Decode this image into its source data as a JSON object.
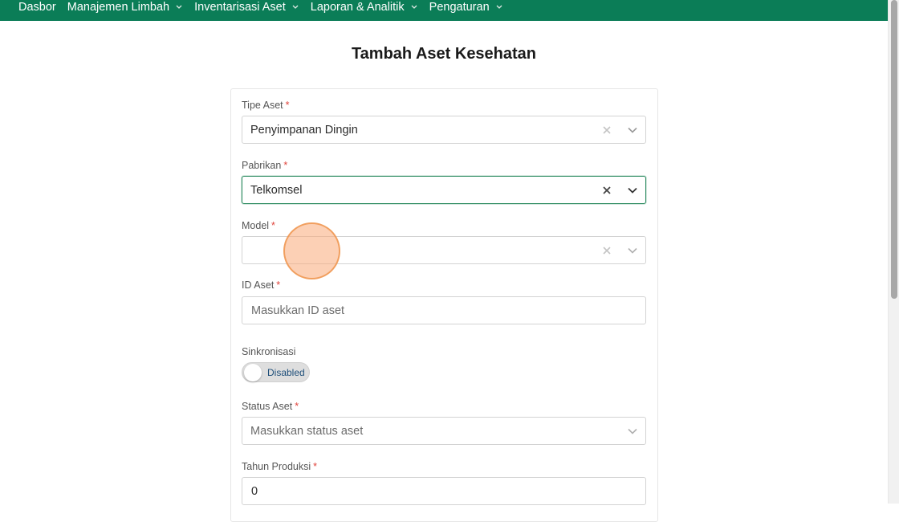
{
  "nav": {
    "items": [
      {
        "label": "Dasbor",
        "has_dropdown": false
      },
      {
        "label": "Manajemen Limbah",
        "has_dropdown": true
      },
      {
        "label": "Inventarisasi Aset",
        "has_dropdown": true
      },
      {
        "label": "Laporan & Analitik",
        "has_dropdown": true
      },
      {
        "label": "Pengaturan",
        "has_dropdown": true
      }
    ],
    "background": "#0b7d57",
    "caret_icon": "chevron-down-icon"
  },
  "page": {
    "title": "Tambah Aset Kesehatan"
  },
  "form": {
    "required_marker": "*",
    "tipe_aset": {
      "label": "Tipe Aset",
      "value": "Penyimpanan Dingin",
      "clear_icon": "close-icon",
      "dropdown_icon": "chevron-down-icon"
    },
    "pabrikan": {
      "label": "Pabrikan",
      "value": "Telkomsel",
      "clear_icon": "close-icon",
      "dropdown_icon": "chevron-down-icon"
    },
    "model": {
      "label": "Model",
      "value": "",
      "clear_icon": "close-icon",
      "dropdown_icon": "chevron-down-icon"
    },
    "id_aset": {
      "label": "ID Aset",
      "placeholder": "Masukkan ID aset"
    },
    "sinkronisasi": {
      "label": "Sinkronisasi",
      "state_text": "Disabled",
      "enabled": false
    },
    "status_aset": {
      "label": "Status Aset",
      "placeholder": "Masukkan status aset",
      "dropdown_icon": "chevron-down-icon"
    },
    "tahun_produksi": {
      "label": "Tahun Produksi",
      "value": "0"
    }
  },
  "colors": {
    "accent": "#0b7d57",
    "focus_border": "#2b8a5f",
    "required": "#e0433b",
    "click_indicator": "#f0a070"
  }
}
